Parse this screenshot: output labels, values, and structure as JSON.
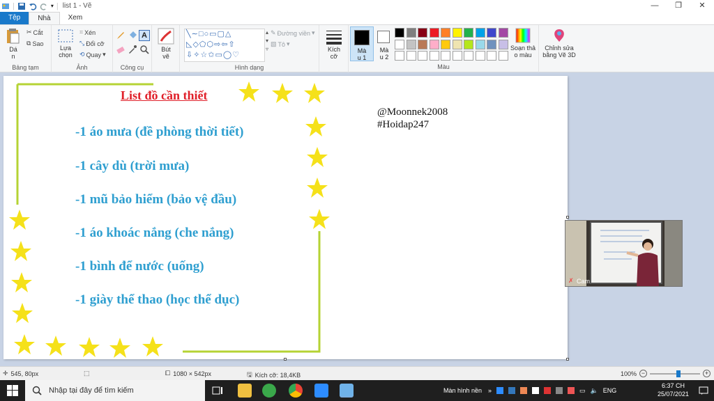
{
  "window": {
    "title": "list 1 - Vẽ",
    "controls": [
      "—",
      "❐",
      "✕"
    ]
  },
  "tabs": [
    "Tệp",
    "Nhà",
    "Xem"
  ],
  "ribbon": {
    "clipboard": {
      "paste": "Dá\nn",
      "cut": "Cắt",
      "copy": "Sao",
      "label": "Bảng tạm"
    },
    "image": {
      "select": "Lựa\nchọn",
      "crop": "Xén",
      "resize": "Đổi cỡ",
      "rotate": "Quay",
      "label": "Ảnh"
    },
    "tools": {
      "label": "Công cụ"
    },
    "brushes": {
      "label": "Bút\nvẽ"
    },
    "shapes": {
      "outline": "Đường viền",
      "fill": "Tô",
      "label": "Hình dạng"
    },
    "size": {
      "label": "Kích\ncỡ"
    },
    "color1": {
      "label": "Mà\nu 1"
    },
    "color2": {
      "label": "Mà\nu 2"
    },
    "colors": {
      "label": "Màu",
      "edit": "Soạn thả\no màu"
    },
    "paint3d": "Chỉnh sửa\nbằng Vẽ 3D"
  },
  "palette": [
    "#000000",
    "#7f7f7f",
    "#880015",
    "#ed1c24",
    "#ff7f27",
    "#fff200",
    "#22b14c",
    "#00a2e8",
    "#3f48cc",
    "#a349a4",
    "#ffffff",
    "#c3c3c3",
    "#b97a57",
    "#ffaec9",
    "#ffc90e",
    "#efe4b0",
    "#b5e61d",
    "#99d9ea",
    "#7092be",
    "#c8bfe7",
    "#ffffff",
    "#ffffff",
    "#ffffff",
    "#ffffff",
    "#ffffff",
    "#ffffff",
    "#ffffff",
    "#ffffff",
    "#ffffff",
    "#ffffff"
  ],
  "canvas": {
    "heading": "List đồ cần thiết",
    "items": [
      "-1 áo mưa (đề phòng thời tiết)",
      "-1 cây dù (trời mưa)",
      "-1 mũ bảo hiểm (bảo vệ đầu)",
      "-1 áo khoác nắng (che nắng)",
      "-1 bình để nước (uống)",
      "-1 giày thể thao (học thể dục)"
    ],
    "credit_1": "@Moonnek2008",
    "credit_2": "#Hoidap247",
    "star_color": "#f5e11a",
    "border_color": "#b5d334"
  },
  "webcam": {
    "label": "Cam"
  },
  "statusbar": {
    "position": "545, 80px",
    "dimensions": "1080 × 542px",
    "filesize": "Kích cỡ: 18,4KB",
    "zoom": "100%"
  },
  "taskbar": {
    "search_placeholder": "Nhập tại đây để tìm kiếm",
    "desktop": "Màn hình nền",
    "lang": "ENG",
    "time": "6:37 CH",
    "date": "25/07/2021"
  }
}
